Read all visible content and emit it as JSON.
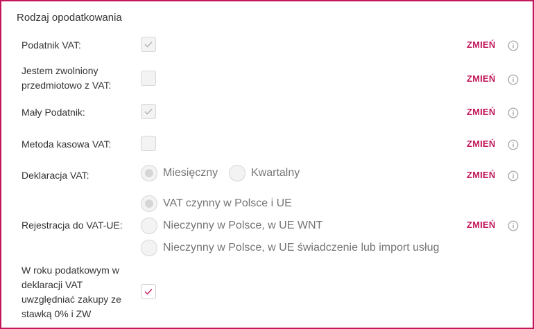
{
  "section_title": "Rodzaj opodatkowania",
  "change_label": "ZMIEŃ",
  "accent_color": "#c2185b",
  "rows": {
    "vat_payer": {
      "label": "Podatnik VAT:",
      "checked": true
    },
    "vat_exempt": {
      "label_line1": "Jestem zwolniony",
      "label_line2": "przedmiotowo z VAT:",
      "checked": false
    },
    "small_taxpayer": {
      "label": "Mały Podatnik:",
      "checked": true
    },
    "cash_method": {
      "label": "Metoda kasowa VAT:",
      "checked": false
    },
    "vat_declaration": {
      "label": "Deklaracja VAT:",
      "options": [
        "Miesięczny",
        "Kwartalny"
      ],
      "selected": "Miesięczny"
    },
    "vat_ue_registration": {
      "label": "Rejestracja do VAT-UE:",
      "options": [
        "VAT czynny w Polsce i UE",
        "Nieczynny w Polsce, w UE WNT",
        "Nieczynny w Polsce, w UE świadczenie lub import usług"
      ],
      "selected": "VAT czynny w Polsce i UE"
    },
    "zero_rate_purchases": {
      "label_lines": [
        "W roku podatkowym w",
        "deklaracji VAT",
        "uwzględniać zakupy ze",
        "stawką 0% i ZW"
      ],
      "checked": true
    }
  }
}
